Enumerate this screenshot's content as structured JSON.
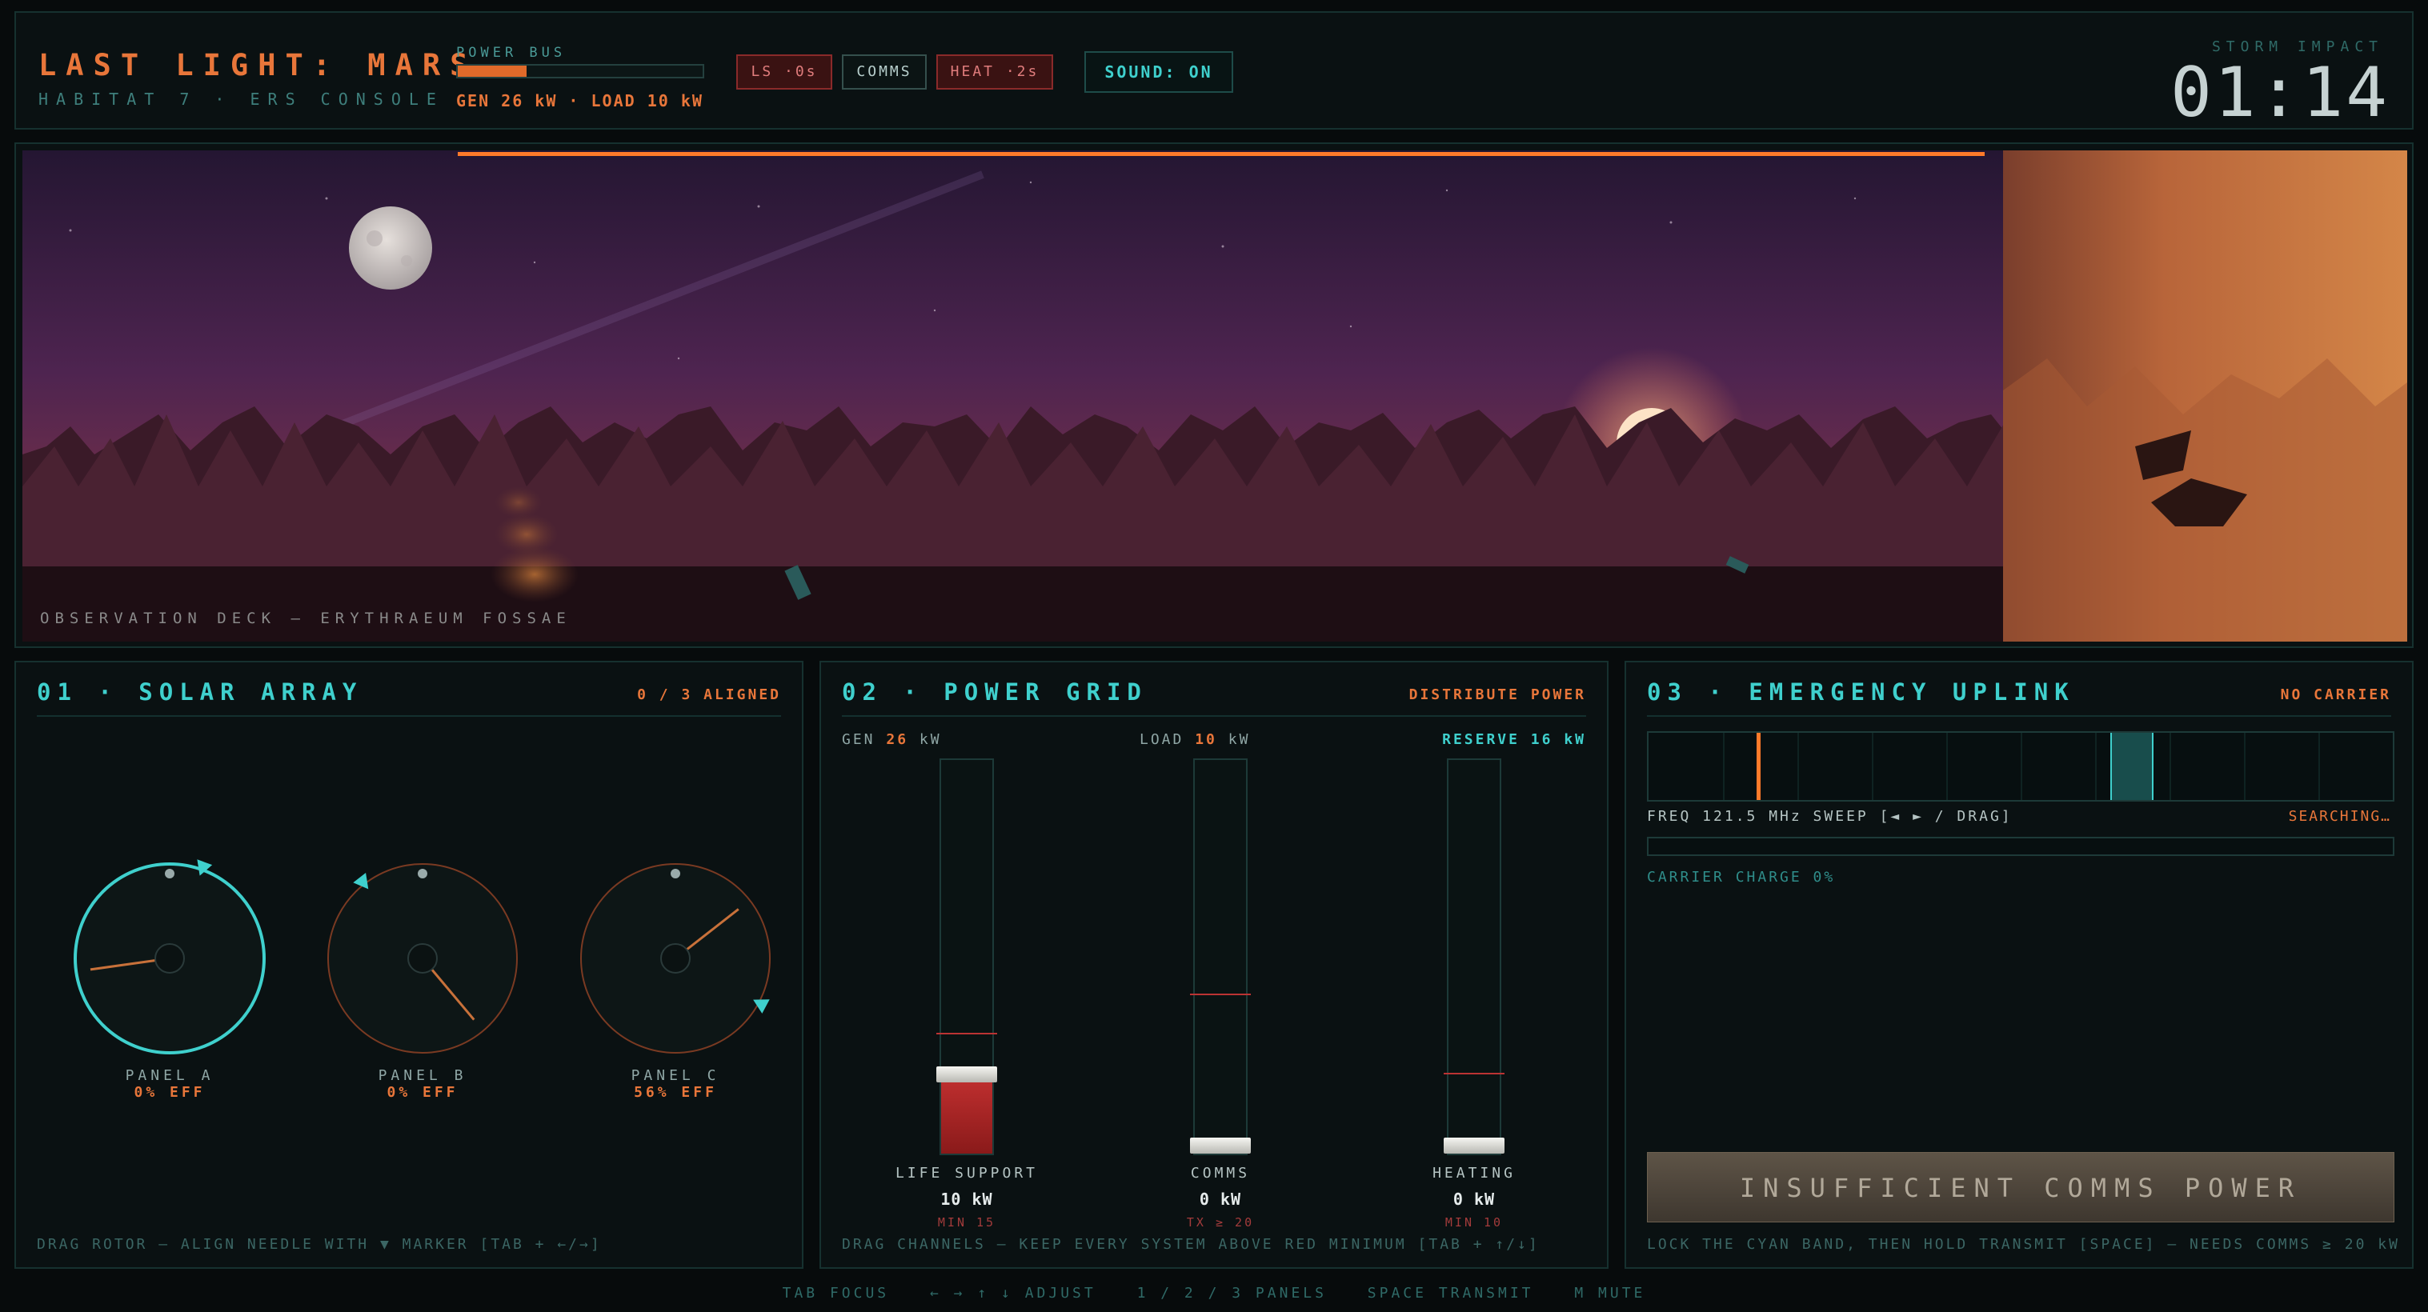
{
  "header": {
    "title": "LAST LIGHT: MARS",
    "subtitle": "HABITAT 7 · ERS CONSOLE",
    "power_bus_label": "POWER BUS",
    "power_bus_fraction": 0.28,
    "power_bus_readout": "GEN 26 kW · LOAD 10 kW",
    "indicators": [
      {
        "label": "LS ·0s",
        "state": "alert"
      },
      {
        "label": "COMMS",
        "state": "neutral"
      },
      {
        "label": "HEAT ·2s",
        "state": "alert"
      }
    ],
    "sound_label": "SOUND: ON",
    "storm_label": "STORM IMPACT",
    "storm_time": "01:14"
  },
  "scene": {
    "caption": "OBSERVATION DECK — ERYTHRAEUM FOSSAE",
    "colors": {
      "sky_top": "#2a1838",
      "sky_mid": "#5a2a52",
      "horizon": "#8a3a4a",
      "storm": "#c8713a",
      "accent": "#ff7a2a"
    }
  },
  "solar": {
    "title": "01 · SOLAR ARRAY",
    "status": "0 / 3 ALIGNED",
    "hint": "DRAG ROTOR — ALIGN NEEDLE WITH ▼ MARKER [TAB + ←/→]",
    "panels": [
      {
        "name": "PANEL A",
        "eff": "0% EFF",
        "needle_deg": 262,
        "marker_deg": 20,
        "selected": true
      },
      {
        "name": "PANEL B",
        "eff": "0% EFF",
        "needle_deg": 140,
        "marker_deg": -38,
        "selected": false
      },
      {
        "name": "PANEL C",
        "eff": "56% EFF",
        "needle_deg": 52,
        "marker_deg": 118,
        "selected": false
      }
    ]
  },
  "grid": {
    "title": "02 · POWER GRID",
    "status": "DISTRIBUTE POWER",
    "gen_label": "GEN",
    "gen_value": "26",
    "gen_unit": "kW",
    "load_label": "LOAD",
    "load_value": "10",
    "load_unit": "kW",
    "reserve": "RESERVE 16 kW",
    "hint": "DRAG CHANNELS — KEEP EVERY SYSTEM ABOVE RED MINIMUM [TAB + ↑/↓]",
    "channels": [
      {
        "name": "LIFE SUPPORT",
        "value": "10 kW",
        "min_label": "MIN 15",
        "level": 0.2,
        "min_level": 0.3
      },
      {
        "name": "COMMS",
        "value": "0 kW",
        "min_label": "TX ≥ 20",
        "level": 0.0,
        "min_level": 0.4
      },
      {
        "name": "HEATING",
        "value": "0 kW",
        "min_label": "MIN 10",
        "level": 0.0,
        "min_level": 0.2
      }
    ]
  },
  "uplink": {
    "title": "03 · EMERGENCY UPLINK",
    "status": "NO CARRIER",
    "freq": "FREQ 121.5 MHz SWEEP [◄ ► / DRAG]",
    "searching": "SEARCHING…",
    "needle_fraction": 0.145,
    "band_fraction": 0.62,
    "charge_fraction": 0.0,
    "charge_label": "CARRIER CHARGE 0%",
    "transmit_label": "INSUFFICIENT COMMS POWER",
    "hint": "LOCK THE CYAN BAND, THEN HOLD TRANSMIT [SPACE] — NEEDS COMMS ≥ 20 kW"
  },
  "footer": {
    "items": [
      "TAB FOCUS",
      "← → ↑ ↓ ADJUST",
      "1 / 2 / 3 PANELS",
      "SPACE TRANSMIT",
      "M MUTE"
    ]
  }
}
